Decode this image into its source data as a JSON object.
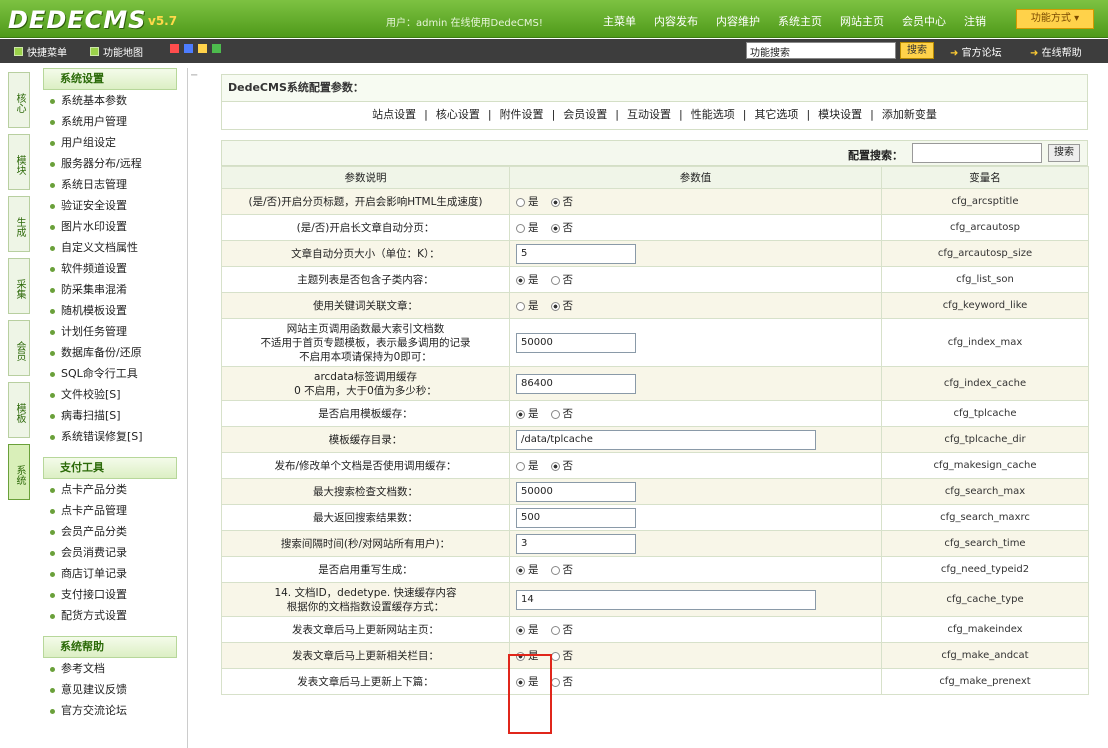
{
  "app": {
    "logo": "DEDECMS",
    "version": "v5.7",
    "user_info": "用户：admin  在线使用DedeCMS!",
    "top_nav": [
      "主菜单",
      "内容发布",
      "内容维护",
      "系统主页",
      "网站主页",
      "会员中心",
      "注销"
    ],
    "function_mode": "功能方式 ▾"
  },
  "subbar": {
    "shortcut_menu": "快捷菜单",
    "function_map": "功能地图",
    "colors": [
      "#ff4d4d",
      "#4d7dff",
      "#ffd24a",
      "#4dbb4d"
    ],
    "search_value": "功能搜索",
    "search_button": "搜索",
    "link_forum": "官方论坛",
    "link_help": "在线帮助"
  },
  "left_tabs": [
    "核心",
    "模块",
    "生成",
    "采集",
    "会员",
    "模板",
    "系统"
  ],
  "sidebar": {
    "groups": [
      {
        "title": "系统设置",
        "items": [
          "系统基本参数",
          "系统用户管理",
          "用户组设定",
          "服务器分布/远程",
          "系统日志管理",
          "验证安全设置",
          "图片水印设置",
          "自定义文档属性",
          "软件频道设置",
          "防采集串混淆",
          "随机模板设置",
          "计划任务管理",
          "数据库备份/还原",
          "SQL命令行工具",
          "文件校验[S]",
          "病毒扫描[S]",
          "系统错误修复[S]"
        ]
      },
      {
        "title": "支付工具",
        "items": [
          "点卡产品分类",
          "点卡产品管理",
          "会员产品分类",
          "会员消费记录",
          "商店订单记录",
          "支付接口设置",
          "配货方式设置"
        ]
      },
      {
        "title": "系统帮助",
        "items": [
          "参考文档",
          "意见建议反馈",
          "官方交流论坛"
        ]
      }
    ]
  },
  "main": {
    "title": "DedeCMS系统配置参数：",
    "tabs": [
      "站点设置",
      "核心设置",
      "附件设置",
      "会员设置",
      "互动设置",
      "性能选项",
      "其它选项",
      "模块设置",
      "添加新变量"
    ],
    "search_label": "配置搜索：",
    "search_button": "搜索",
    "columns": [
      "参数说明",
      "参数值",
      "变量名"
    ],
    "yes": "是",
    "no": "否",
    "rows": [
      {
        "desc": "(是/否)开启分页标题，开启会影响HTML生成速度)",
        "type": "radio",
        "value": "no",
        "var": "cfg_arcsptitle"
      },
      {
        "desc": "(是/否)开启长文章自动分页：",
        "type": "radio",
        "value": "no",
        "var": "cfg_arcautosp"
      },
      {
        "desc": "文章自动分页大小（单位：K）：",
        "type": "text",
        "value": "5",
        "var": "cfg_arcautosp_size"
      },
      {
        "desc": "主题列表是否包含子类内容：",
        "type": "radio",
        "value": "yes",
        "var": "cfg_list_son"
      },
      {
        "desc": "使用关键词关联文章：",
        "type": "radio",
        "value": "no",
        "var": "cfg_keyword_like"
      },
      {
        "desc": "网站主页调用函数最大索引文档数\n不适用于首页专题模板，表示最多调用的记录\n不启用本项请保持为0即可：",
        "type": "text",
        "value": "50000",
        "var": "cfg_index_max"
      },
      {
        "desc": "arcdata标签调用缓存\n0 不启用，大于0值为多少秒：",
        "type": "text",
        "value": "86400",
        "var": "cfg_index_cache"
      },
      {
        "desc": "是否启用模板缓存：",
        "type": "radio",
        "value": "yes",
        "var": "cfg_tplcache"
      },
      {
        "desc": "模板缓存目录：",
        "type": "textwide",
        "value": "/data/tplcache",
        "var": "cfg_tplcache_dir"
      },
      {
        "desc": "发布/修改单个文档是否使用调用缓存：",
        "type": "radio",
        "value": "no",
        "var": "cfg_makesign_cache"
      },
      {
        "desc": "最大搜索检查文档数：",
        "type": "text",
        "value": "50000",
        "var": "cfg_search_max"
      },
      {
        "desc": "最大返回搜索结果数：",
        "type": "text",
        "value": "500",
        "var": "cfg_search_maxrc"
      },
      {
        "desc": "搜索间隔时间(秒/对网站所有用户)：",
        "type": "text",
        "value": "3",
        "var": "cfg_search_time"
      },
      {
        "desc": "是否启用重写生成：",
        "type": "radio",
        "value": "yes",
        "var": "cfg_need_typeid2"
      },
      {
        "desc": "14. 文档ID，dedetype. 快速缓存内容\n根据你的文档指数设置缓存方式：",
        "type": "textwide",
        "value": "14",
        "var": "cfg_cache_type"
      },
      {
        "desc": "发表文章后马上更新网站主页：",
        "type": "radio",
        "value": "yes",
        "var": "cfg_makeindex"
      },
      {
        "desc": "发表文章后马上更新相关栏目：",
        "type": "radio",
        "value": "yes",
        "var": "cfg_make_andcat"
      },
      {
        "desc": "发表文章后马上更新上下篇：",
        "type": "radio",
        "value": "yes",
        "var": "cfg_make_prenext"
      }
    ]
  }
}
